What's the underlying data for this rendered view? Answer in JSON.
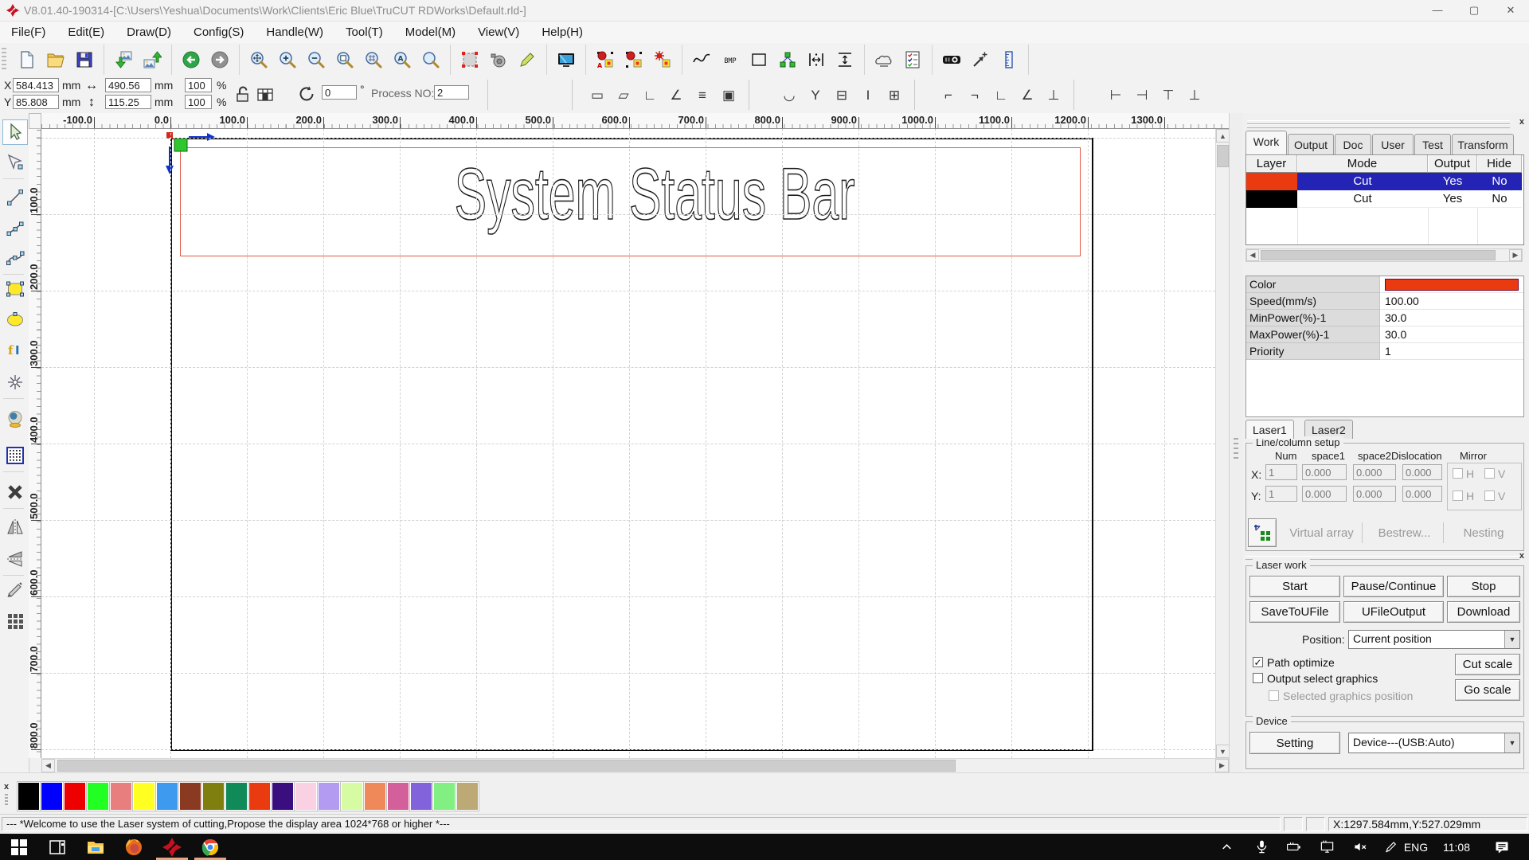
{
  "window": {
    "title": "V8.01.40-190314-[C:\\Users\\Yeshua\\Documents\\Work\\Clients\\Eric Blue\\TruCUT RDWorks\\Default.rld-]",
    "controls": [
      "minimize",
      "maximize",
      "close"
    ]
  },
  "menu": {
    "items": [
      "File(F)",
      "Edit(E)",
      "Draw(D)",
      "Config(S)",
      "Handle(W)",
      "Tool(T)",
      "Model(M)",
      "View(V)",
      "Help(H)"
    ]
  },
  "toolbars": {
    "main_groups": [
      [
        "new-file",
        "open-file",
        "save-file"
      ],
      [
        "import-file",
        "export-file"
      ],
      [
        "view-back",
        "view-forward"
      ],
      [
        "zoom-pan",
        "zoom-in",
        "zoom-out",
        "zoom-page",
        "zoom-select",
        "zoom-all",
        "zoom-tool"
      ],
      [
        "marquee-select",
        "capture-view",
        "edit-pen"
      ],
      [
        "preview-monitor"
      ],
      [
        "node-edit-warn",
        "node-edit",
        "node-edit-star"
      ],
      [
        "curve-tool",
        "bmp-tool",
        "rect-draw",
        "node-link",
        "distribute-h",
        "distribute-v"
      ],
      [
        "laser-machine",
        "output-list"
      ],
      [
        "projector",
        "pick-position",
        "ruler-tool"
      ]
    ],
    "coords": {
      "x_label": "X",
      "y_label": "Y",
      "x": "584.413",
      "y": "85.808",
      "w": "490.56",
      "h": "115.25",
      "unit": "mm",
      "w_scale": "100",
      "h_scale": "100",
      "percent": "%",
      "rotate": "0",
      "degree": "°",
      "process_label": "Process NO:",
      "process_value": "2"
    },
    "align_groups": [
      [
        {
          "name": "weld",
          "glyph": "▭"
        },
        {
          "name": "trim",
          "glyph": "▱"
        },
        {
          "name": "corner-cut",
          "glyph": "∟"
        },
        {
          "name": "chamfer",
          "glyph": "∠"
        },
        {
          "name": "combine",
          "glyph": "≡"
        },
        {
          "name": "group",
          "glyph": "▣"
        }
      ],
      [
        {
          "name": "curve-smooth",
          "glyph": "◡"
        },
        {
          "name": "node-join",
          "glyph": "Y"
        },
        {
          "name": "close-path",
          "glyph": "⊟"
        },
        {
          "name": "text-path",
          "glyph": "I"
        },
        {
          "name": "grid-array",
          "glyph": "⊞"
        }
      ],
      [
        {
          "name": "align-corner-tl",
          "glyph": "⌐"
        },
        {
          "name": "align-corner-tr",
          "glyph": "¬"
        },
        {
          "name": "align-corner-bl",
          "glyph": "∟"
        },
        {
          "name": "align-corner-br",
          "glyph": "∠"
        },
        {
          "name": "align-center",
          "glyph": "⊥"
        }
      ],
      [
        {
          "name": "align-left-edge",
          "glyph": "⊢"
        },
        {
          "name": "align-right-edge",
          "glyph": "⊣"
        },
        {
          "name": "align-top-edge",
          "glyph": "⊤"
        },
        {
          "name": "align-bottom-edge",
          "glyph": "⊥"
        }
      ]
    ]
  },
  "left_toolbar": {
    "items": [
      "select",
      "node-edit",
      "line",
      "polyline",
      "bezier",
      "rectangle",
      "ellipse",
      "text",
      "star",
      "sphere-3d",
      "dot-grid",
      "delete",
      "mirror-horizontal",
      "mirror-vertical",
      "offset-tool",
      "array-copy"
    ],
    "selected": 0
  },
  "rulers": {
    "top": [
      "-100.0",
      "0.0",
      "100.0",
      "200.0",
      "300.0",
      "400.0",
      "500.0",
      "600.0",
      "700.0",
      "800.0",
      "900.0",
      "1000.0",
      "1100.0",
      "1200.0",
      "1300.0"
    ],
    "left": [
      "100.0",
      "200.0",
      "300.0",
      "400.0",
      "500.0",
      "600.0",
      "700.0",
      "800.0"
    ]
  },
  "canvas": {
    "design_text": "System Status Bar"
  },
  "panel": {
    "tabs": [
      "Work",
      "Output",
      "Doc",
      "User",
      "Test",
      "Transform"
    ],
    "active_tab": "Work",
    "layer_table": {
      "headers": [
        "Layer",
        "Mode",
        "Output",
        "Hide"
      ],
      "rows": [
        {
          "color": "#ea3b10",
          "mode": "Cut",
          "output": "Yes",
          "hide": "No",
          "selected": true
        },
        {
          "color": "#000000",
          "mode": "Cut",
          "output": "Yes",
          "hide": "No",
          "selected": false
        }
      ],
      "selection_color": "#2323b5"
    },
    "properties": [
      {
        "label": "Color",
        "value": "",
        "swatch": "#ea3b10"
      },
      {
        "label": "Speed(mm/s)",
        "value": "100.00"
      },
      {
        "label": "MinPower(%)-1",
        "value": "30.0"
      },
      {
        "label": "MaxPower(%)-1",
        "value": "30.0"
      },
      {
        "label": "Priority",
        "value": "1"
      }
    ],
    "laser_tabs": [
      "Laser1",
      "Laser2"
    ],
    "line_column": {
      "title": "Line/column setup",
      "headers": [
        "Num",
        "space1",
        "space2",
        "Dislocation",
        "Mirror"
      ],
      "row_x_label": "X:",
      "row_y_label": "Y:",
      "x_values": [
        "1",
        "0.000",
        "0.000",
        "0.000"
      ],
      "y_values": [
        "1",
        "0.000",
        "0.000",
        "0.000"
      ],
      "mirror_labels": [
        "H",
        "V"
      ],
      "buttons": [
        "Virtual array",
        "Bestrew...",
        "Nesting"
      ]
    },
    "laser_work": {
      "title": "Laser work",
      "row1": [
        "Start",
        "Pause/Continue",
        "Stop"
      ],
      "row2": [
        "SaveToUFile",
        "UFileOutput",
        "Download"
      ],
      "position_label": "Position:",
      "position_value": "Current position",
      "checks": [
        {
          "label": "Path optimize",
          "checked": true,
          "disabled": false
        },
        {
          "label": "Output select graphics",
          "checked": false,
          "disabled": false
        },
        {
          "label": "Selected graphics position",
          "checked": false,
          "disabled": true
        }
      ],
      "scale_buttons": [
        "Cut scale",
        "Go scale"
      ]
    },
    "device": {
      "title": "Device",
      "setting_button": "Setting",
      "device_value": "Device---(USB:Auto)"
    }
  },
  "palette": {
    "colors": [
      "#000000",
      "#0000ff",
      "#ee0000",
      "#22ff22",
      "#e87e7e",
      "#ffff22",
      "#3e9aef",
      "#8a3a20",
      "#7e7f0f",
      "#108a59",
      "#e93a10",
      "#3b0e80",
      "#fad1e3",
      "#b29bf0",
      "#d6fba2",
      "#f0895a",
      "#d4609b",
      "#8263db",
      "#81ef81",
      "#bda976"
    ]
  },
  "statusbar": {
    "message": "--- *Welcome to use the Laser system of cutting,Propose the display area 1024*768 or higher *---",
    "coords": "X:1297.584mm,Y:527.029mm"
  },
  "taskbar": {
    "apps": [
      "start",
      "task-view",
      "file-explorer",
      "firefox",
      "rdworks",
      "chrome"
    ],
    "active_apps": [
      4,
      5
    ],
    "tray_icons": [
      "tray-expand",
      "microphone",
      "battery",
      "network-display",
      "volume-muted",
      "pen-input"
    ],
    "language": "ENG",
    "time": "11:08",
    "notification_icon": "notification"
  }
}
